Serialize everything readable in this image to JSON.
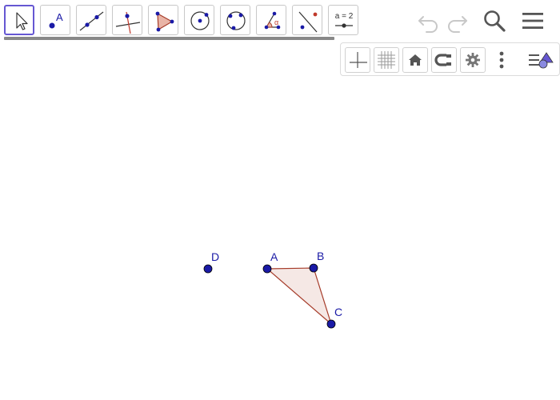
{
  "toolbar": {
    "tools": [
      {
        "name": "move-tool",
        "icon": "cursor-arrow-icon"
      },
      {
        "name": "point-tool",
        "icon": "point-icon",
        "label": "A"
      },
      {
        "name": "line-tool",
        "icon": "line-through-two-points-icon"
      },
      {
        "name": "perpendicular-line-tool",
        "icon": "perpendicular-line-icon"
      },
      {
        "name": "polygon-tool",
        "icon": "polygon-icon"
      },
      {
        "name": "circle-tool",
        "icon": "circle-center-point-icon"
      },
      {
        "name": "conic-tool",
        "icon": "circle-three-points-icon"
      },
      {
        "name": "angle-tool",
        "icon": "angle-icon",
        "label": "α"
      },
      {
        "name": "reflect-tool",
        "icon": "reflect-about-line-icon"
      },
      {
        "name": "slider-tool",
        "icon": "slider-icon",
        "label": "a = 2"
      }
    ],
    "selected_tool": "move-tool",
    "right_icons": [
      "undo-icon",
      "redo-icon",
      "search-icon",
      "menu-icon"
    ]
  },
  "style_bar": {
    "buttons": [
      "axes-icon",
      "grid-icon",
      "home-icon",
      "point-capturing-icon",
      "settings-icon",
      "more-vertical-icon",
      "style-bar-toggle-icon"
    ]
  },
  "graphics": {
    "points": [
      {
        "label": "A"
      },
      {
        "label": "B"
      },
      {
        "label": "C"
      },
      {
        "label": "D"
      }
    ],
    "polygon": {
      "vertices": [
        "A",
        "B",
        "C"
      ],
      "fill_color": "#f5e8e5",
      "stroke_color": "#a63c2a"
    },
    "point_color": "#1a1aa6",
    "accent_color": "#6557d2"
  }
}
